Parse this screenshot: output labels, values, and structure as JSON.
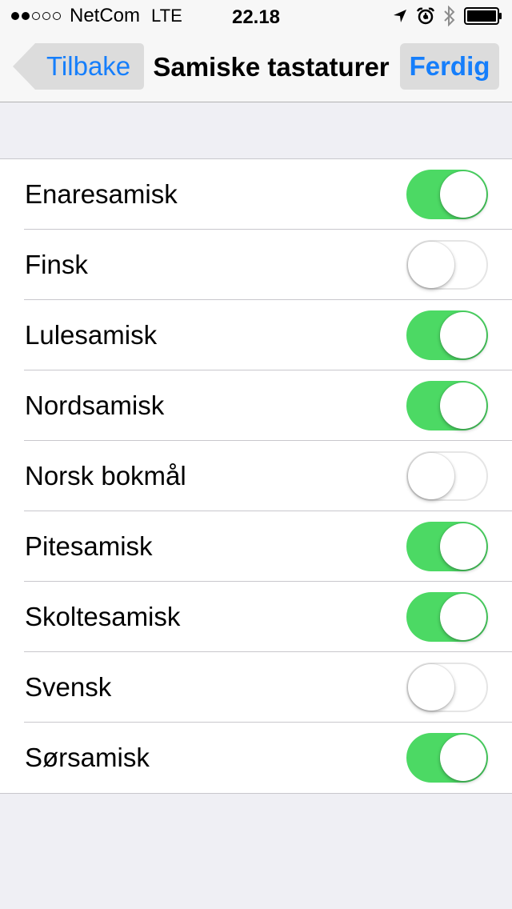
{
  "status_bar": {
    "signal_filled": 2,
    "signal_empty": 3,
    "carrier": "NetCom",
    "network": "LTE",
    "time": "22.18",
    "icons": [
      "location-arrow-icon",
      "alarm-icon",
      "bluetooth-icon",
      "battery-icon"
    ],
    "battery_level": 1.0
  },
  "nav": {
    "back_label": "Tilbake",
    "title": "Samiske tastaturer",
    "done_label": "Ferdig"
  },
  "colors": {
    "accent": "#157efb",
    "toggle_on": "#4cd964",
    "background": "#efeff4"
  },
  "keyboards": [
    {
      "label": "Enaresamisk",
      "enabled": true
    },
    {
      "label": "Finsk",
      "enabled": false
    },
    {
      "label": "Lulesamisk",
      "enabled": true
    },
    {
      "label": "Nordsamisk",
      "enabled": true
    },
    {
      "label": "Norsk bokmål",
      "enabled": false
    },
    {
      "label": "Pitesamisk",
      "enabled": true
    },
    {
      "label": "Skoltesamisk",
      "enabled": true
    },
    {
      "label": "Svensk",
      "enabled": false
    },
    {
      "label": "Sørsamisk",
      "enabled": true
    }
  ]
}
